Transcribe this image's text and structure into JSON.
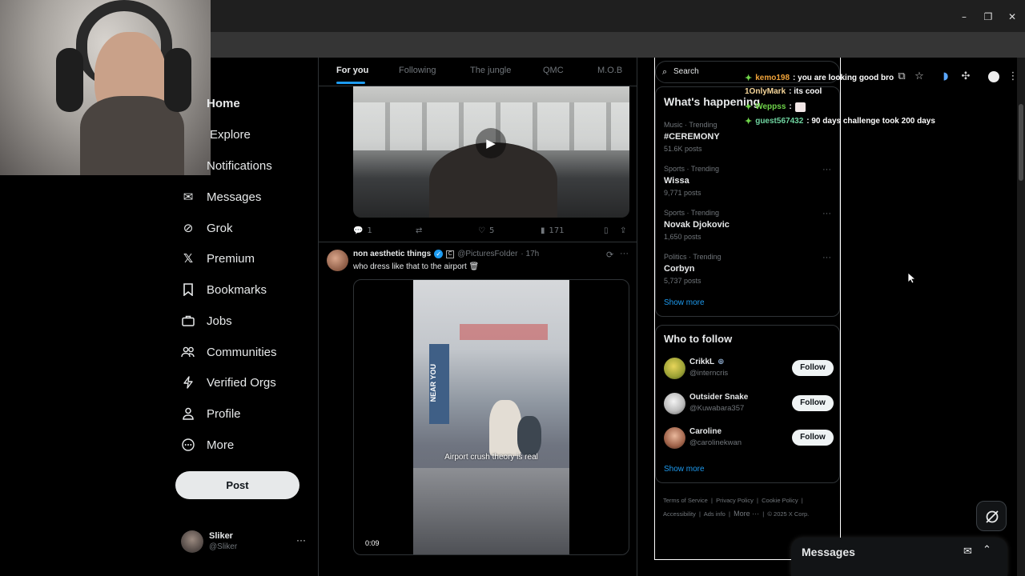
{
  "colors": {
    "accent": "#1d9bf0",
    "background": "#000000",
    "text": "#e7e9ea",
    "muted": "#71767b",
    "chat_user_orange": "#f0a33a",
    "chat_user_green": "#6fd44a"
  },
  "nav": {
    "items": [
      {
        "label": "Home",
        "icon": "home-icon"
      },
      {
        "label": "Explore",
        "icon": "search-icon"
      },
      {
        "label": "Notifications",
        "icon": "bell-icon"
      },
      {
        "label": "Messages",
        "icon": "envelope-icon"
      },
      {
        "label": "Grok",
        "icon": "grok-icon"
      },
      {
        "label": "Premium",
        "icon": "x-logo-icon"
      },
      {
        "label": "Bookmarks",
        "icon": "bookmark-icon"
      },
      {
        "label": "Jobs",
        "icon": "briefcase-icon"
      },
      {
        "label": "Communities",
        "icon": "people-icon"
      },
      {
        "label": "Verified Orgs",
        "icon": "lightning-icon"
      },
      {
        "label": "Profile",
        "icon": "person-icon"
      },
      {
        "label": "More",
        "icon": "more-circle-icon"
      }
    ],
    "post_label": "Post",
    "account": {
      "name": "Sliker",
      "handle": "@Sliker"
    }
  },
  "feed": {
    "tabs": [
      "For you",
      "Following",
      "The jungle",
      "QMC",
      "M.O.B"
    ],
    "tweet1": {
      "replies": "1",
      "likes": "5",
      "views": "171"
    },
    "tweet2": {
      "author": "non aesthetic things",
      "handle": "@PicturesFoIder",
      "time": "· 17h",
      "text": "who dress like that to the airport 🗑",
      "caption": "Airport crush theory is real",
      "sign": "NEAR YOU",
      "duration": "0:09"
    }
  },
  "right": {
    "search_placeholder": "Search",
    "happening_title": "What's happening",
    "trends": [
      {
        "meta": "Music · Trending",
        "name": "#CEREMONY",
        "posts": "51.6K posts"
      },
      {
        "meta": "Sports · Trending",
        "name": "Wissa",
        "posts": "9,771 posts"
      },
      {
        "meta": "Sports · Trending",
        "name": "Novak Djokovic",
        "posts": "1,650 posts"
      },
      {
        "meta": "Politics · Trending",
        "name": "Corbyn",
        "posts": "5,737 posts"
      }
    ],
    "show_more": "Show more",
    "follow_title": "Who to follow",
    "follow": [
      {
        "name": "CrikkL",
        "handle": "@interncris",
        "button": "Follow"
      },
      {
        "name": "Outsider Snake",
        "handle": "@Kuwabara357",
        "button": "Follow"
      },
      {
        "name": "Caroline",
        "handle": "@carolinekwan",
        "button": "Follow"
      }
    ],
    "footer": [
      "Terms of Service",
      "Privacy Policy",
      "Cookie Policy",
      "Accessibility",
      "Ads info",
      "More ···",
      "© 2025 X Corp."
    ]
  },
  "chat": [
    {
      "user": "kemo198",
      "msg": ": you are looking good bro"
    },
    {
      "user": "1OnlyMark",
      "msg": ": its cool"
    },
    {
      "user": "Weppss",
      "msg": ":"
    },
    {
      "user": "guest567432",
      "msg": ": 90 days challenge took 200 days"
    }
  ],
  "messages_bar": {
    "title": "Messages"
  }
}
